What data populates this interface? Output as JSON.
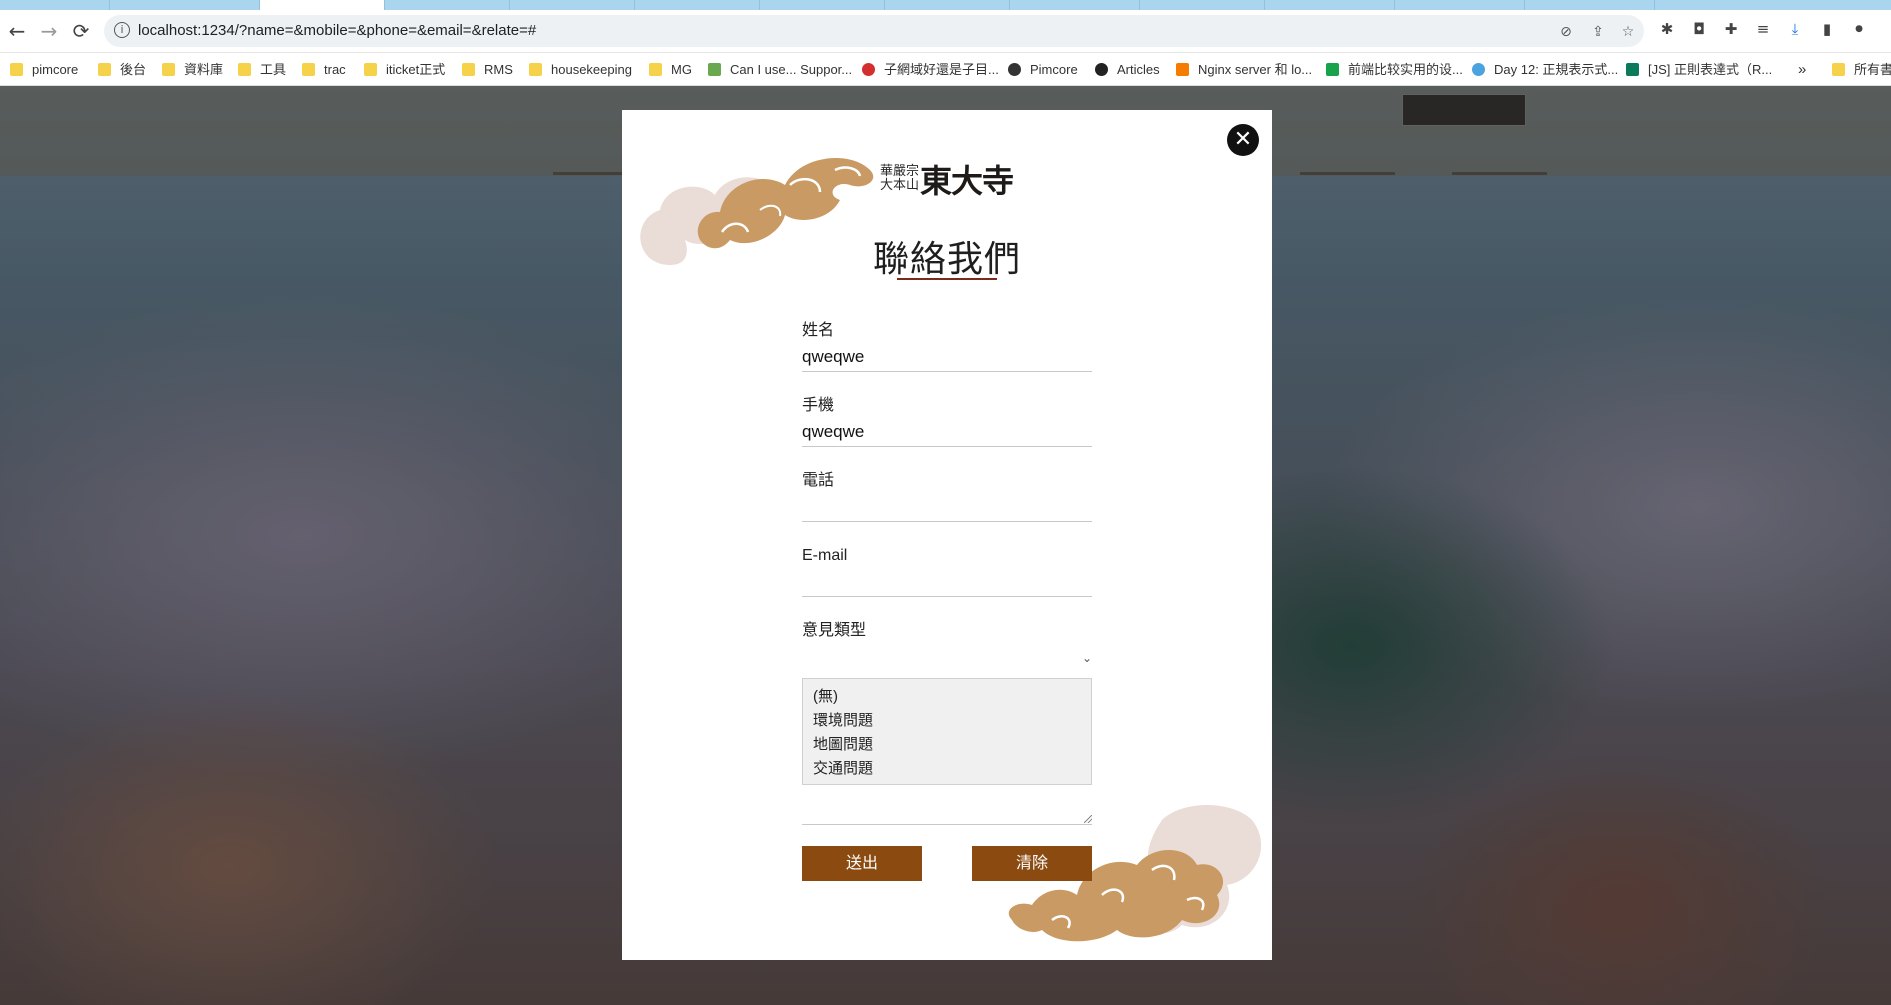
{
  "browser": {
    "url": "localhost:1234/?name=&mobile=&phone=&email=&relate=#",
    "nav": {
      "back_icon": "←",
      "forward_icon": "→",
      "reload_icon": "⟳",
      "info_icon": "i"
    },
    "toolbar_icons": [
      "eye-off-icon",
      "share-icon",
      "star-icon",
      "bug-icon",
      "camera-icon",
      "puzzle-icon",
      "playlist-icon",
      "download-icon",
      "sidepanel-icon",
      "profile-icon"
    ],
    "bookmarks": [
      {
        "label": "pimcore",
        "icon": "folder"
      },
      {
        "label": "後台",
        "icon": "folder"
      },
      {
        "label": "資料庫",
        "icon": "folder"
      },
      {
        "label": "工具",
        "icon": "folder"
      },
      {
        "label": "trac",
        "icon": "folder"
      },
      {
        "label": "iticket正式",
        "icon": "folder"
      },
      {
        "label": "RMS",
        "icon": "folder"
      },
      {
        "label": "housekeeping",
        "icon": "folder"
      },
      {
        "label": "MG",
        "icon": "folder"
      },
      {
        "label": "Can I use... Suppor...",
        "icon": "caniuse"
      },
      {
        "label": "子網域好還是子目...",
        "icon": "site-a"
      },
      {
        "label": "Pimcore",
        "icon": "pimcore"
      },
      {
        "label": "Articles",
        "icon": "globe"
      },
      {
        "label": "Nginx server 和 lo...",
        "icon": "blogger"
      },
      {
        "label": "前端比较实用的设...",
        "icon": "sf"
      },
      {
        "label": "Day 12: 正規表示式...",
        "icon": "ithome"
      },
      {
        "label": "[JS] 正則表達式（R...",
        "icon": "pj"
      },
      {
        "label": "»",
        "icon": "none"
      },
      {
        "label": "所有書",
        "icon": "folder"
      }
    ]
  },
  "modal": {
    "brand_sub": "華嚴宗 大本山",
    "brand_main": "東大寺",
    "title": "聯絡我們",
    "close_icon": "✕",
    "fields": {
      "name": {
        "label": "姓名",
        "value": "qweqwe"
      },
      "mobile": {
        "label": "手機",
        "value": "qweqwe"
      },
      "phone": {
        "label": "電話",
        "value": ""
      },
      "email": {
        "label": "E-mail",
        "value": ""
      },
      "type": {
        "label": "意見類型",
        "value": "",
        "caret": "⌄"
      }
    },
    "listbox_options": [
      "(無)",
      "環境問題",
      "地圖問題",
      "交通問題"
    ],
    "buttons": {
      "submit": "送出",
      "clear": "清除"
    },
    "colors": {
      "button": "#8a4a10",
      "underline": "#7a2b1c",
      "cloud_gold": "#c99a63",
      "cloud_pink": "#eadcd6"
    }
  }
}
